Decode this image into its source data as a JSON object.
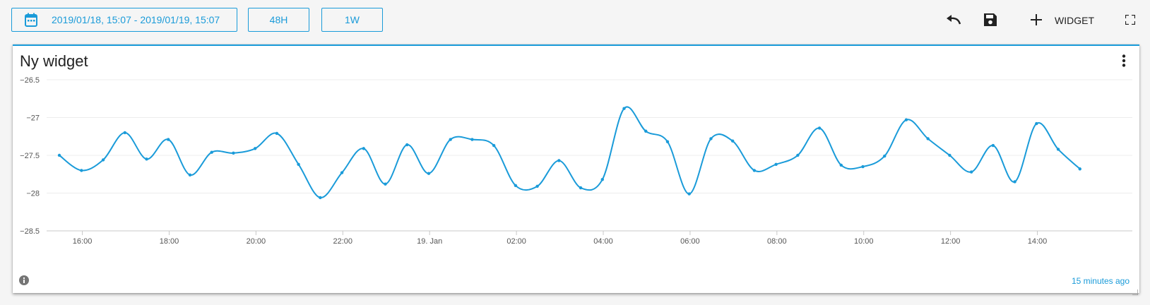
{
  "toolbar": {
    "date_range": "2019/01/18, 15:07 - 2019/01/19, 15:07",
    "period_48h": "48H",
    "period_1w": "1W",
    "add_widget_label": "WIDGET"
  },
  "widget": {
    "title": "Ny widget",
    "updated_text": "15 minutes ago"
  },
  "colors": {
    "accent": "#1a9bd9",
    "line": "#1a9bd9",
    "text": "#222222"
  },
  "icons": [
    "calendar-icon",
    "undo-icon",
    "save-icon",
    "plus-icon",
    "fullscreen-icon",
    "more-vert-icon",
    "info-icon"
  ],
  "chart_data": {
    "type": "line",
    "title": "",
    "xlabel": "",
    "ylabel": "",
    "ylim": [
      -28.5,
      -26.5
    ],
    "yticks": [
      -26.5,
      -27,
      -27.5,
      -28,
      -28.5
    ],
    "ytick_labels": [
      "−26.5",
      "−27",
      "−27.5",
      "−28",
      "−28.5"
    ],
    "xticks": [
      {
        "label": "16:00",
        "h": 1
      },
      {
        "label": "18:00",
        "h": 3
      },
      {
        "label": "20:00",
        "h": 5
      },
      {
        "label": "22:00",
        "h": 7
      },
      {
        "label": "19. Jan",
        "h": 9
      },
      {
        "label": "02:00",
        "h": 11
      },
      {
        "label": "04:00",
        "h": 13
      },
      {
        "label": "06:00",
        "h": 15
      },
      {
        "label": "08:00",
        "h": 17
      },
      {
        "label": "10:00",
        "h": 19
      },
      {
        "label": "12:00",
        "h": 21
      },
      {
        "label": "14:00",
        "h": 23
      }
    ],
    "x_start_h": 0.47,
    "x_end_h": 24,
    "grid": true,
    "series": [
      {
        "points": [
          [
            0.47,
            -27.5
          ],
          [
            0.98,
            -27.7
          ],
          [
            1.48,
            -27.56
          ],
          [
            1.98,
            -27.2
          ],
          [
            2.48,
            -27.55
          ],
          [
            2.98,
            -27.29
          ],
          [
            3.48,
            -27.76
          ],
          [
            3.98,
            -27.46
          ],
          [
            4.48,
            -27.47
          ],
          [
            4.98,
            -27.41
          ],
          [
            5.48,
            -27.21
          ],
          [
            5.98,
            -27.62
          ],
          [
            6.48,
            -28.06
          ],
          [
            6.98,
            -27.73
          ],
          [
            7.48,
            -27.41
          ],
          [
            7.98,
            -27.88
          ],
          [
            8.48,
            -27.36
          ],
          [
            8.98,
            -27.74
          ],
          [
            9.48,
            -27.29
          ],
          [
            9.98,
            -27.29
          ],
          [
            10.48,
            -27.37
          ],
          [
            10.98,
            -27.9
          ],
          [
            11.48,
            -27.91
          ],
          [
            11.98,
            -27.57
          ],
          [
            12.48,
            -27.93
          ],
          [
            12.98,
            -27.82
          ],
          [
            13.48,
            -26.88
          ],
          [
            13.98,
            -27.18
          ],
          [
            14.48,
            -27.32
          ],
          [
            14.98,
            -28.01
          ],
          [
            15.48,
            -27.28
          ],
          [
            15.98,
            -27.31
          ],
          [
            16.48,
            -27.7
          ],
          [
            16.98,
            -27.62
          ],
          [
            17.48,
            -27.5
          ],
          [
            17.98,
            -27.14
          ],
          [
            18.48,
            -27.63
          ],
          [
            18.98,
            -27.65
          ],
          [
            19.48,
            -27.51
          ],
          [
            19.98,
            -27.03
          ],
          [
            20.48,
            -27.28
          ],
          [
            20.98,
            -27.5
          ],
          [
            21.48,
            -27.72
          ],
          [
            21.98,
            -27.37
          ],
          [
            22.48,
            -27.85
          ],
          [
            22.98,
            -27.08
          ],
          [
            23.48,
            -27.42
          ],
          [
            23.98,
            -27.68
          ]
        ]
      }
    ]
  }
}
